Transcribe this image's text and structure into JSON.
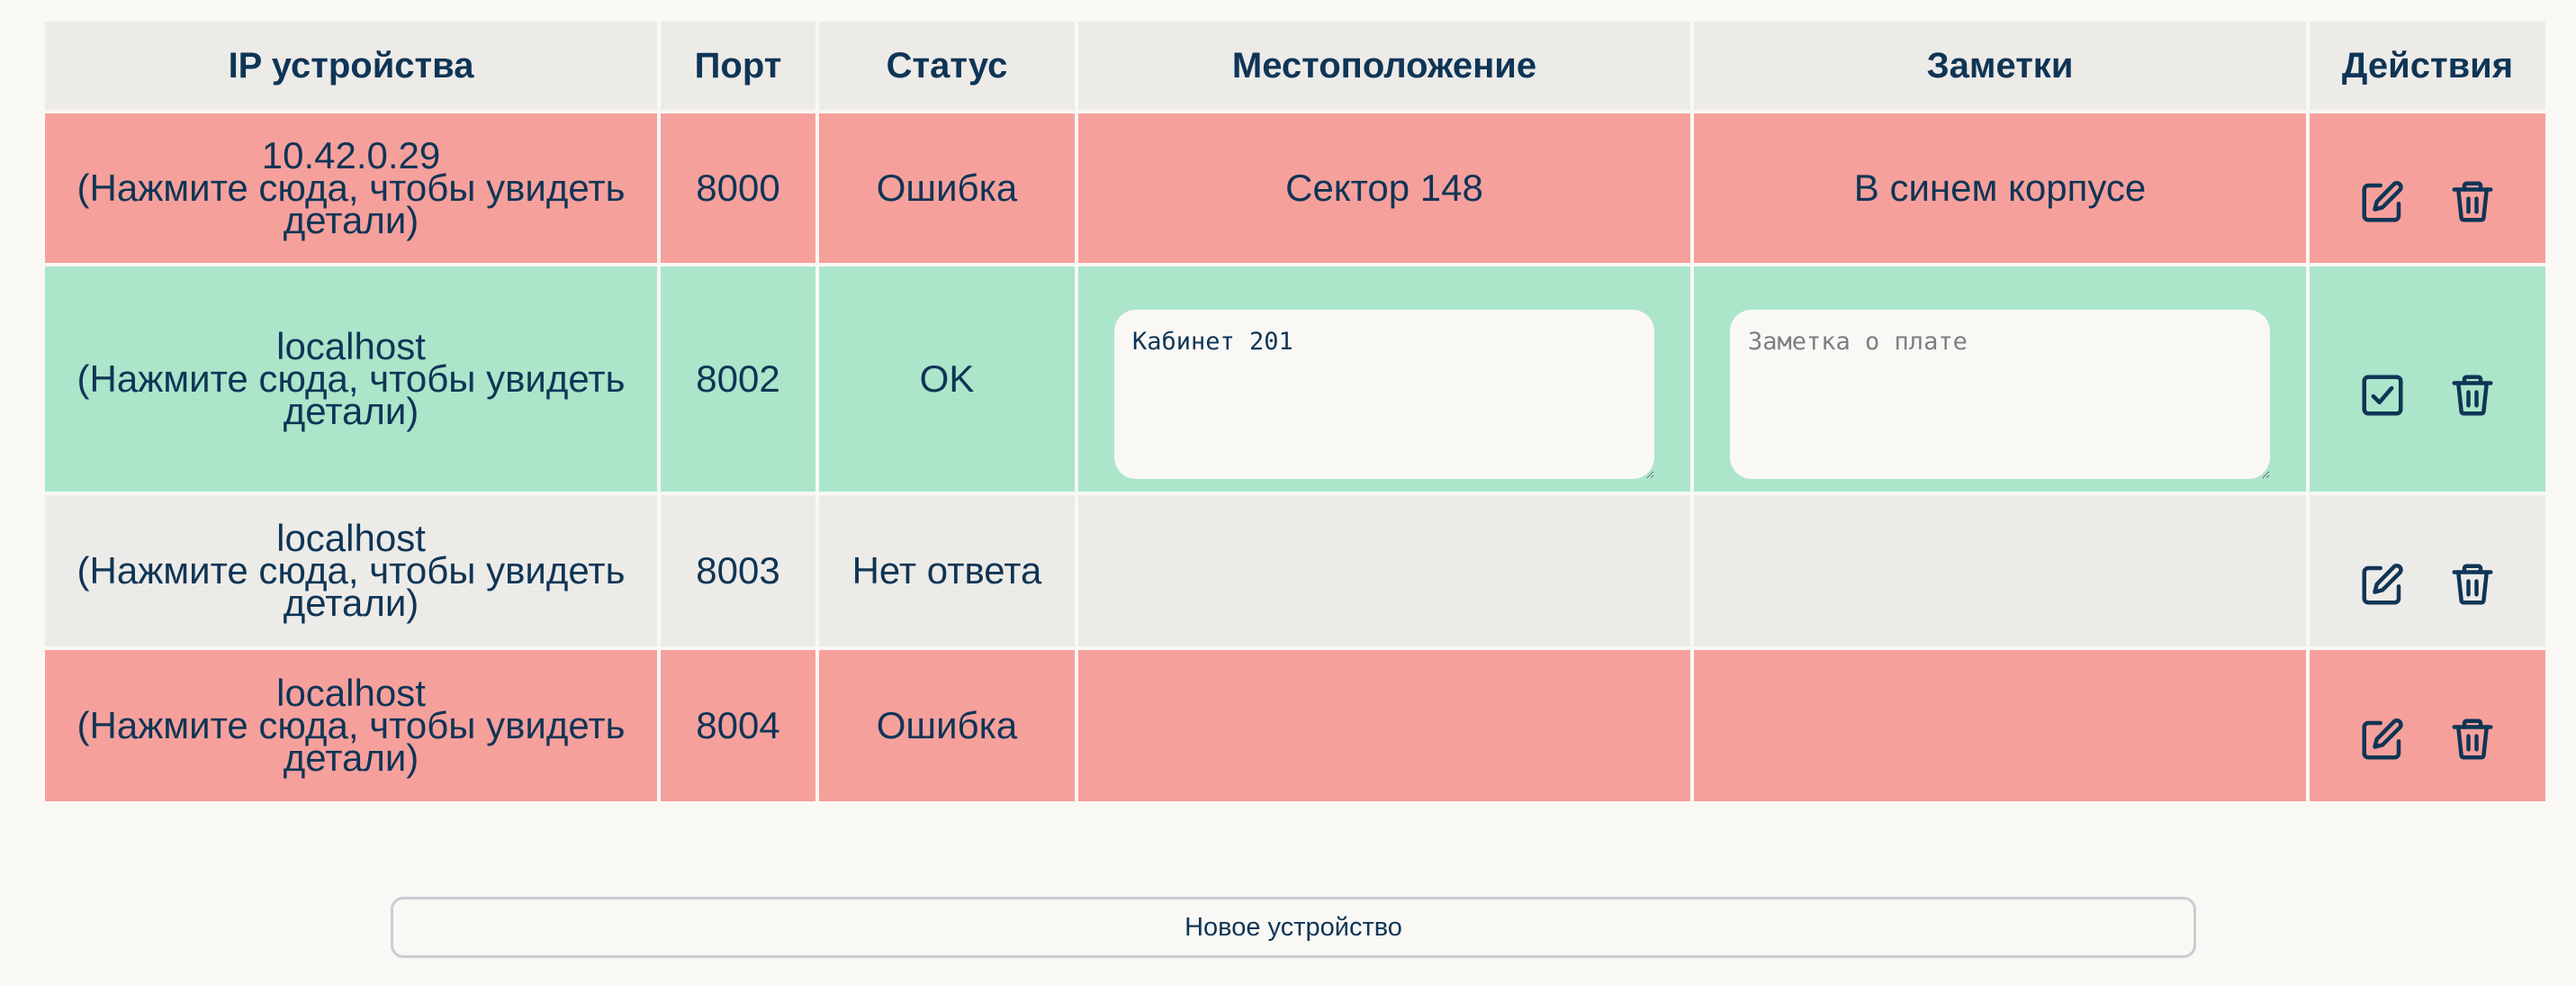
{
  "table": {
    "headers": [
      "IP устройства",
      "Порт",
      "Статус",
      "Местоположение",
      "Заметки",
      "Действия"
    ],
    "rows": [
      {
        "host": "10.42.0.29",
        "details_hint": "(Нажмите сюда, чтобы увидеть детали)",
        "port": "8000",
        "status": "Ошибка",
        "location": "Сектор 148",
        "notes": "В синем корпусе"
      },
      {
        "host": "localhost",
        "details_hint": "(Нажмите сюда, чтобы увидеть детали)",
        "port": "8002",
        "status": "OK",
        "location_value": "Кабинет 201",
        "notes_placeholder": "Заметка о плате"
      },
      {
        "host": "localhost",
        "details_hint": "(Нажмите сюда, чтобы увидеть детали)",
        "port": "8003",
        "status": "Нет ответа",
        "location": "",
        "notes": ""
      },
      {
        "host": "localhost",
        "details_hint": "(Нажмите сюда, чтобы увидеть детали)",
        "port": "8004",
        "status": "Ошибка",
        "location": "",
        "notes": ""
      }
    ]
  },
  "new_device_button": "Новое устройство",
  "icons": {
    "edit": "edit-icon",
    "confirm": "checkbox-check-icon",
    "delete": "trash-icon"
  },
  "colors": {
    "error_row": "#f6a09c",
    "ok_row": "#abe5ca",
    "no_response_row": "#edebe8",
    "header_bg": "#edebe8",
    "text": "#0f3556"
  }
}
